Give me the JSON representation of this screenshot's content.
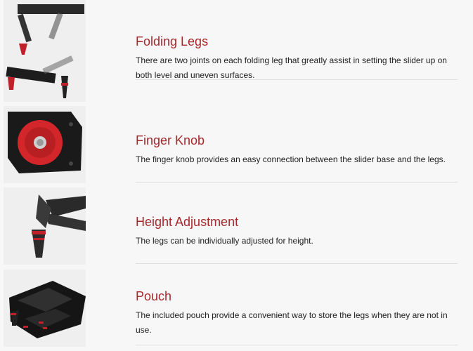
{
  "features": [
    {
      "title": "Folding Legs",
      "description": "There are two joints on each folding leg that greatly assist in setting the slider up on both level and uneven surfaces.",
      "image_subject": "folding-legs-photo"
    },
    {
      "title": "Finger Knob",
      "description": "The finger knob provides an easy connection between the slider base and the legs.",
      "image_subject": "finger-knob-photo"
    },
    {
      "title": "Height Adjustment",
      "description": "The legs can be individually adjusted for height.",
      "image_subject": "height-adjustment-photo"
    },
    {
      "title": "Pouch",
      "description": "The included pouch provide a convenient way to store the legs when they are not in use.",
      "image_subject": "pouch-photo"
    }
  ],
  "colors": {
    "title": "#a8282d",
    "text": "#222222",
    "divider": "#dedede",
    "background": "#f7f7f7"
  }
}
